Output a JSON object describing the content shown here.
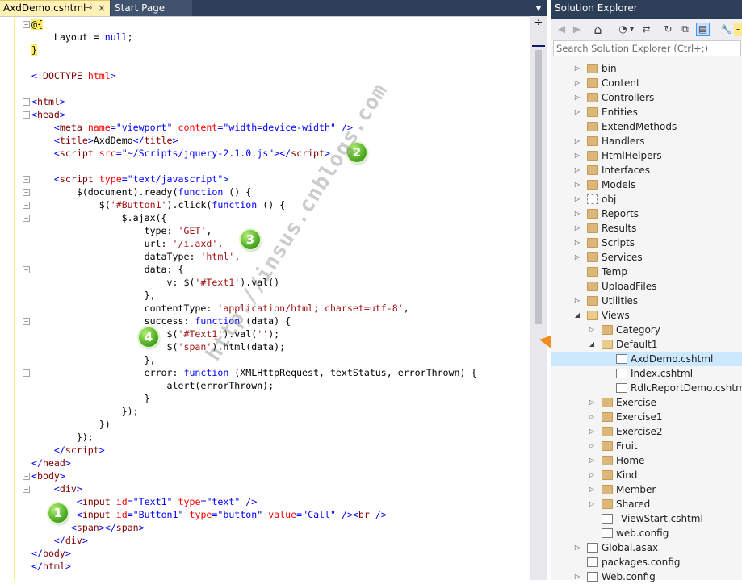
{
  "editor": {
    "tabs": [
      {
        "label": "AxdDemo.cshtml",
        "pin": "⊸",
        "close": "×"
      },
      {
        "label": "Start Page"
      }
    ],
    "dropdown": "▼",
    "split": "÷",
    "lines": [
      [
        {
          "t": "@{",
          "c": "tok-razor"
        }
      ],
      [
        {
          "t": "    Layout = "
        },
        {
          "t": "null",
          "c": "tok-kw"
        },
        {
          "t": ";"
        }
      ],
      [
        {
          "t": "}",
          "c": "tok-razor"
        }
      ],
      [],
      [
        {
          "t": "<!",
          "c": "tok-kw"
        },
        {
          "t": "DOCTYPE",
          "c": "tok-tag"
        },
        {
          "t": " "
        },
        {
          "t": "html",
          "c": "tok-attr"
        },
        {
          "t": ">",
          "c": "tok-kw"
        }
      ],
      [],
      [
        {
          "t": "<",
          "c": "tok-kw"
        },
        {
          "t": "html",
          "c": "tok-tag"
        },
        {
          "t": ">",
          "c": "tok-kw"
        }
      ],
      [
        {
          "t": "<",
          "c": "tok-kw"
        },
        {
          "t": "head",
          "c": "tok-tag"
        },
        {
          "t": ">",
          "c": "tok-kw"
        }
      ],
      [
        {
          "t": "    "
        },
        {
          "t": "<",
          "c": "tok-kw"
        },
        {
          "t": "meta",
          "c": "tok-tag"
        },
        {
          "t": " "
        },
        {
          "t": "name",
          "c": "tok-attr"
        },
        {
          "t": "=",
          "c": "tok-kw"
        },
        {
          "t": "\"viewport\"",
          "c": "tok-val"
        },
        {
          "t": " "
        },
        {
          "t": "content",
          "c": "tok-attr"
        },
        {
          "t": "=",
          "c": "tok-kw"
        },
        {
          "t": "\"width=device-width\"",
          "c": "tok-val"
        },
        {
          "t": " />",
          "c": "tok-kw"
        }
      ],
      [
        {
          "t": "    "
        },
        {
          "t": "<",
          "c": "tok-kw"
        },
        {
          "t": "title",
          "c": "tok-tag"
        },
        {
          "t": ">",
          "c": "tok-kw"
        },
        {
          "t": "AxdDemo"
        },
        {
          "t": "</",
          "c": "tok-kw"
        },
        {
          "t": "title",
          "c": "tok-tag"
        },
        {
          "t": ">",
          "c": "tok-kw"
        }
      ],
      [
        {
          "t": "    "
        },
        {
          "t": "<",
          "c": "tok-kw"
        },
        {
          "t": "script",
          "c": "tok-tag"
        },
        {
          "t": " "
        },
        {
          "t": "src",
          "c": "tok-attr"
        },
        {
          "t": "=",
          "c": "tok-kw"
        },
        {
          "t": "\"~/Scripts/jquery-2.1.0.js\"",
          "c": "tok-val"
        },
        {
          "t": "></",
          "c": "tok-kw"
        },
        {
          "t": "script",
          "c": "tok-tag"
        },
        {
          "t": ">",
          "c": "tok-kw"
        }
      ],
      [],
      [
        {
          "t": "    "
        },
        {
          "t": "<",
          "c": "tok-kw"
        },
        {
          "t": "script",
          "c": "tok-tag"
        },
        {
          "t": " "
        },
        {
          "t": "type",
          "c": "tok-attr"
        },
        {
          "t": "=",
          "c": "tok-kw"
        },
        {
          "t": "\"text/javascript\"",
          "c": "tok-val"
        },
        {
          "t": ">",
          "c": "tok-kw"
        }
      ],
      [
        {
          "t": "        $(document).ready("
        },
        {
          "t": "function",
          "c": "tok-kw"
        },
        {
          "t": " () {"
        }
      ],
      [
        {
          "t": "            $("
        },
        {
          "t": "'#Button1'",
          "c": "tok-str"
        },
        {
          "t": ").click("
        },
        {
          "t": "function",
          "c": "tok-kw"
        },
        {
          "t": " () {"
        }
      ],
      [
        {
          "t": "                $.ajax({"
        }
      ],
      [
        {
          "t": "                    type: "
        },
        {
          "t": "'GET'",
          "c": "tok-str"
        },
        {
          "t": ","
        }
      ],
      [
        {
          "t": "                    url: "
        },
        {
          "t": "'/i.axd'",
          "c": "tok-str"
        },
        {
          "t": ","
        }
      ],
      [
        {
          "t": "                    dataType: "
        },
        {
          "t": "'html'",
          "c": "tok-str"
        },
        {
          "t": ","
        }
      ],
      [
        {
          "t": "                    data: {"
        }
      ],
      [
        {
          "t": "                        v: $("
        },
        {
          "t": "'#Text1'",
          "c": "tok-str"
        },
        {
          "t": ").val()"
        }
      ],
      [
        {
          "t": "                    },"
        }
      ],
      [
        {
          "t": "                    contentType: "
        },
        {
          "t": "'application/html; charset=utf-8'",
          "c": "tok-str"
        },
        {
          "t": ","
        }
      ],
      [
        {
          "t": "                    success: "
        },
        {
          "t": "function",
          "c": "tok-kw"
        },
        {
          "t": " (data) {"
        }
      ],
      [
        {
          "t": "                        $("
        },
        {
          "t": "'#Text1'",
          "c": "tok-str"
        },
        {
          "t": ").val("
        },
        {
          "t": "''",
          "c": "tok-str"
        },
        {
          "t": ");"
        }
      ],
      [
        {
          "t": "                        $("
        },
        {
          "t": "'span'",
          "c": "tok-str"
        },
        {
          "t": ").html(data);"
        }
      ],
      [
        {
          "t": "                    },"
        }
      ],
      [
        {
          "t": "                    error: "
        },
        {
          "t": "function",
          "c": "tok-kw"
        },
        {
          "t": " (XMLHttpRequest, textStatus, errorThrown) {"
        }
      ],
      [
        {
          "t": "                        alert(errorThrown);"
        }
      ],
      [
        {
          "t": "                    }"
        }
      ],
      [
        {
          "t": "                });"
        }
      ],
      [
        {
          "t": "            })"
        }
      ],
      [
        {
          "t": "        });"
        }
      ],
      [
        {
          "t": "    "
        },
        {
          "t": "</",
          "c": "tok-kw"
        },
        {
          "t": "script",
          "c": "tok-tag"
        },
        {
          "t": ">",
          "c": "tok-kw"
        }
      ],
      [
        {
          "t": "</",
          "c": "tok-kw"
        },
        {
          "t": "head",
          "c": "tok-tag"
        },
        {
          "t": ">",
          "c": "tok-kw"
        }
      ],
      [
        {
          "t": "<",
          "c": "tok-kw"
        },
        {
          "t": "body",
          "c": "tok-tag"
        },
        {
          "t": ">",
          "c": "tok-kw"
        }
      ],
      [
        {
          "t": "    "
        },
        {
          "t": "<",
          "c": "tok-kw"
        },
        {
          "t": "div",
          "c": "tok-tag"
        },
        {
          "t": ">",
          "c": "tok-kw"
        }
      ],
      [
        {
          "t": "        "
        },
        {
          "t": "<",
          "c": "tok-kw"
        },
        {
          "t": "input",
          "c": "tok-tag"
        },
        {
          "t": " "
        },
        {
          "t": "id",
          "c": "tok-attr"
        },
        {
          "t": "=",
          "c": "tok-kw"
        },
        {
          "t": "\"Text1\"",
          "c": "tok-val"
        },
        {
          "t": " "
        },
        {
          "t": "type",
          "c": "tok-attr"
        },
        {
          "t": "=",
          "c": "tok-kw"
        },
        {
          "t": "\"text\"",
          "c": "tok-val"
        },
        {
          "t": " />",
          "c": "tok-kw"
        }
      ],
      [
        {
          "t": "        "
        },
        {
          "t": "<",
          "c": "tok-kw"
        },
        {
          "t": "input",
          "c": "tok-tag"
        },
        {
          "t": " "
        },
        {
          "t": "id",
          "c": "tok-attr"
        },
        {
          "t": "=",
          "c": "tok-kw"
        },
        {
          "t": "\"Button1\"",
          "c": "tok-val"
        },
        {
          "t": " "
        },
        {
          "t": "type",
          "c": "tok-attr"
        },
        {
          "t": "=",
          "c": "tok-kw"
        },
        {
          "t": "\"button\"",
          "c": "tok-val"
        },
        {
          "t": " "
        },
        {
          "t": "value",
          "c": "tok-attr"
        },
        {
          "t": "=",
          "c": "tok-kw"
        },
        {
          "t": "\"Call\"",
          "c": "tok-val"
        },
        {
          "t": " /><",
          "c": "tok-kw"
        },
        {
          "t": "br",
          "c": "tok-tag"
        },
        {
          "t": " />",
          "c": "tok-kw"
        }
      ],
      [
        {
          "t": "       "
        },
        {
          "t": "<",
          "c": "tok-kw"
        },
        {
          "t": "span",
          "c": "tok-tag"
        },
        {
          "t": "></",
          "c": "tok-kw"
        },
        {
          "t": "span",
          "c": "tok-tag"
        },
        {
          "t": ">",
          "c": "tok-kw"
        }
      ],
      [
        {
          "t": "    "
        },
        {
          "t": "</",
          "c": "tok-kw"
        },
        {
          "t": "div",
          "c": "tok-tag"
        },
        {
          "t": ">",
          "c": "tok-kw"
        }
      ],
      [
        {
          "t": "</",
          "c": "tok-kw"
        },
        {
          "t": "body",
          "c": "tok-tag"
        },
        {
          "t": ">",
          "c": "tok-kw"
        }
      ],
      [
        {
          "t": "</",
          "c": "tok-kw"
        },
        {
          "t": "html",
          "c": "tok-tag"
        },
        {
          "t": ">",
          "c": "tok-kw"
        }
      ]
    ],
    "collapse_lines": [
      0,
      6,
      7,
      12,
      13,
      14,
      15,
      19,
      23,
      27,
      35,
      36
    ],
    "badges": [
      "1",
      "2",
      "3",
      "4"
    ],
    "watermark": "http://insus.cnblogs.com"
  },
  "explorer": {
    "title": "Solution Explorer",
    "toolbar": {
      "back": "◀",
      "forward": "▶",
      "home": "⌂",
      "history": "◔",
      "history_drop": "▾",
      "sync": "⇄",
      "refresh": "↻",
      "collapse": "⧉",
      "show_all": "▤",
      "properties": "🔧",
      "more": "-"
    },
    "search_placeholder": "Search Solution Explorer (Ctrl+;)",
    "items": [
      {
        "label": "bin",
        "level": 0,
        "arrow": "▷",
        "icon": "folder"
      },
      {
        "label": "Content",
        "level": 0,
        "arrow": "▷",
        "icon": "folder"
      },
      {
        "label": "Controllers",
        "level": 0,
        "arrow": "▷",
        "icon": "folder"
      },
      {
        "label": "Entities",
        "level": 0,
        "arrow": "▷",
        "icon": "folder"
      },
      {
        "label": "ExtendMethods",
        "level": 0,
        "arrow": "",
        "icon": "folder"
      },
      {
        "label": "Handlers",
        "level": 0,
        "arrow": "▷",
        "icon": "folder"
      },
      {
        "label": "HtmlHelpers",
        "level": 0,
        "arrow": "▷",
        "icon": "folder"
      },
      {
        "label": "Interfaces",
        "level": 0,
        "arrow": "▷",
        "icon": "folder"
      },
      {
        "label": "Models",
        "level": 0,
        "arrow": "▷",
        "icon": "folder"
      },
      {
        "label": "obj",
        "level": 0,
        "arrow": "▷",
        "icon": "folder-empty"
      },
      {
        "label": "Reports",
        "level": 0,
        "arrow": "▷",
        "icon": "folder"
      },
      {
        "label": "Results",
        "level": 0,
        "arrow": "▷",
        "icon": "folder"
      },
      {
        "label": "Scripts",
        "level": 0,
        "arrow": "▷",
        "icon": "folder"
      },
      {
        "label": "Services",
        "level": 0,
        "arrow": "▷",
        "icon": "folder"
      },
      {
        "label": "Temp",
        "level": 0,
        "arrow": "",
        "icon": "folder"
      },
      {
        "label": "UploadFiles",
        "level": 0,
        "arrow": "",
        "icon": "folder"
      },
      {
        "label": "Utilities",
        "level": 0,
        "arrow": "▷",
        "icon": "folder"
      },
      {
        "label": "Views",
        "level": 0,
        "arrow": "◢",
        "icon": "folder-open"
      },
      {
        "label": "Category",
        "level": 1,
        "arrow": "▷",
        "icon": "folder"
      },
      {
        "label": "Default1",
        "level": 1,
        "arrow": "◢",
        "icon": "folder-open"
      },
      {
        "label": "AxdDemo.cshtml",
        "level": 2,
        "arrow": "",
        "icon": "file",
        "selected": true
      },
      {
        "label": "Index.cshtml",
        "level": 2,
        "arrow": "",
        "icon": "file"
      },
      {
        "label": "RdlcReportDemo.cshtml",
        "level": 2,
        "arrow": "",
        "icon": "file"
      },
      {
        "label": "Exercise",
        "level": 1,
        "arrow": "▷",
        "icon": "folder"
      },
      {
        "label": "Exercise1",
        "level": 1,
        "arrow": "▷",
        "icon": "folder"
      },
      {
        "label": "Exercise2",
        "level": 1,
        "arrow": "▷",
        "icon": "folder"
      },
      {
        "label": "Fruit",
        "level": 1,
        "arrow": "▷",
        "icon": "folder"
      },
      {
        "label": "Home",
        "level": 1,
        "arrow": "▷",
        "icon": "folder"
      },
      {
        "label": "Kind",
        "level": 1,
        "arrow": "▷",
        "icon": "folder"
      },
      {
        "label": "Member",
        "level": 1,
        "arrow": "▷",
        "icon": "folder"
      },
      {
        "label": "Shared",
        "level": 1,
        "arrow": "▷",
        "icon": "folder"
      },
      {
        "label": "_ViewStart.cshtml",
        "level": 1,
        "arrow": "",
        "icon": "file"
      },
      {
        "label": "web.config",
        "level": 1,
        "arrow": "",
        "icon": "file"
      },
      {
        "label": "Global.asax",
        "level": 0,
        "arrow": "▷",
        "icon": "file"
      },
      {
        "label": "packages.config",
        "level": 0,
        "arrow": "",
        "icon": "file"
      },
      {
        "label": "Web.config",
        "level": 0,
        "arrow": "▷",
        "icon": "file"
      }
    ]
  },
  "colors": {
    "title_bar": "#2d3e58",
    "active_tab": "#fff1b8",
    "selection": "#cce8ff",
    "arrow": "#f28c1e",
    "badge": "#56b32a"
  }
}
